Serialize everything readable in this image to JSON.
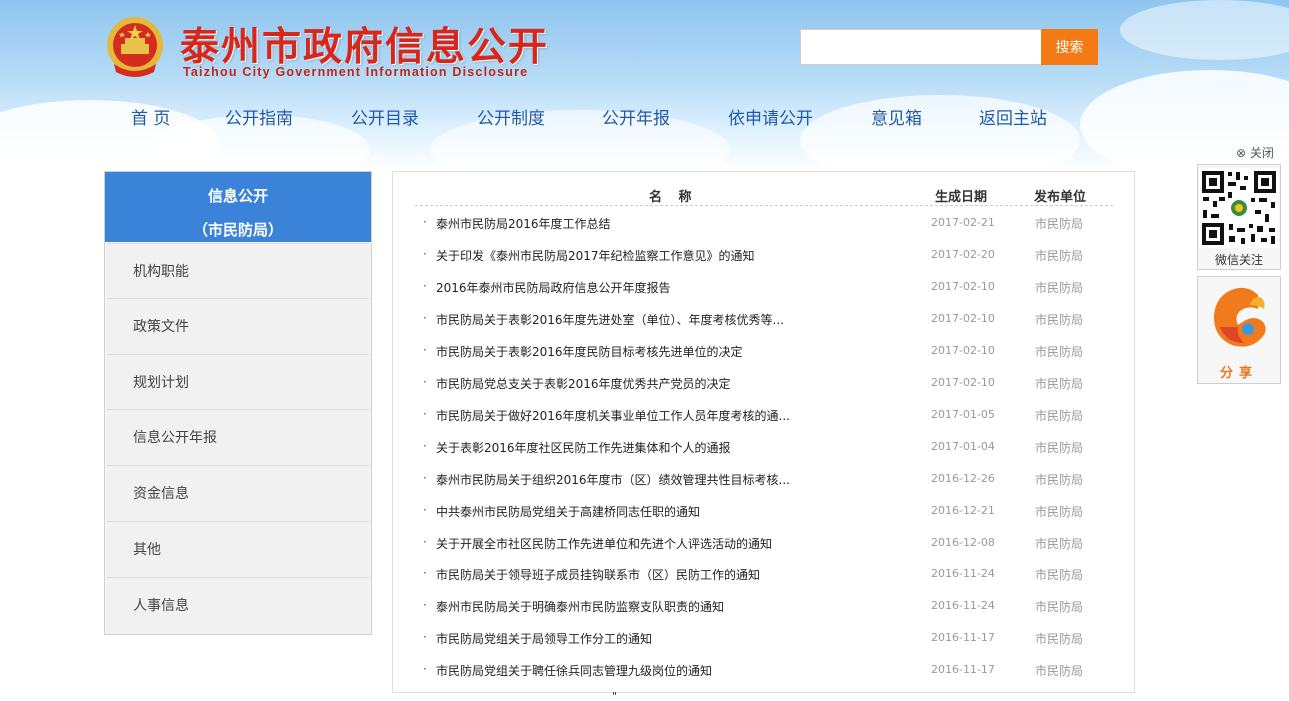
{
  "header": {
    "title": "泰州市政府信息公开",
    "subtitle": "Taizhou City Government Information Disclosure",
    "search": {
      "value": "",
      "placeholder": "",
      "button_label": "搜索"
    }
  },
  "nav": {
    "items": [
      {
        "label": "首 页"
      },
      {
        "label": "公开指南"
      },
      {
        "label": "公开目录"
      },
      {
        "label": "公开制度"
      },
      {
        "label": "公开年报"
      },
      {
        "label": "依申请公开"
      },
      {
        "label": "意见箱"
      },
      {
        "label": "返回主站"
      }
    ]
  },
  "sidebar": {
    "title": "信息公开",
    "subtitle": "（市民防局）",
    "items": [
      {
        "label": "机构职能"
      },
      {
        "label": "政策文件"
      },
      {
        "label": "规划计划"
      },
      {
        "label": "信息公开年报"
      },
      {
        "label": "资金信息"
      },
      {
        "label": "其他"
      },
      {
        "label": "人事信息"
      }
    ]
  },
  "list": {
    "columns": {
      "name": "名 称",
      "date": "生成日期",
      "unit": "发布单位"
    },
    "rows": [
      {
        "title": "泰州市民防局2016年度工作总结",
        "date": "2017-02-21",
        "unit": "市民防局"
      },
      {
        "title": "关于印发《泰州市民防局2017年纪检监察工作意见》的通知",
        "date": "2017-02-20",
        "unit": "市民防局"
      },
      {
        "title": "2016年泰州市民防局政府信息公开年度报告",
        "date": "2017-02-10",
        "unit": "市民防局"
      },
      {
        "title": "市民防局关于表彰2016年度先进处室（单位）、年度考核优秀等...",
        "date": "2017-02-10",
        "unit": "市民防局"
      },
      {
        "title": "市民防局关于表彰2016年度民防目标考核先进单位的决定",
        "date": "2017-02-10",
        "unit": "市民防局"
      },
      {
        "title": "市民防局党总支关于表彰2016年度优秀共产党员的决定",
        "date": "2017-02-10",
        "unit": "市民防局"
      },
      {
        "title": "市民防局关于做好2016年度机关事业单位工作人员年度考核的通...",
        "date": "2017-01-05",
        "unit": "市民防局"
      },
      {
        "title": "关于表彰2016年度社区民防工作先进集体和个人的通报",
        "date": "2017-01-04",
        "unit": "市民防局"
      },
      {
        "title": "泰州市民防局关于组织2016年度市（区）绩效管理共性目标考核...",
        "date": "2016-12-26",
        "unit": "市民防局"
      },
      {
        "title": "中共泰州市民防局党组关于高建桥同志任职的通知",
        "date": "2016-12-21",
        "unit": "市民防局"
      },
      {
        "title": "关于开展全市社区民防工作先进单位和先进个人评选活动的通知",
        "date": "2016-12-08",
        "unit": "市民防局"
      },
      {
        "title": "市民防局关于领导班子成员挂钩联系市（区）民防工作的通知",
        "date": "2016-11-24",
        "unit": "市民防局"
      },
      {
        "title": "泰州市民防局关于明确泰州市民防监察支队职责的通知",
        "date": "2016-11-24",
        "unit": "市民防局"
      },
      {
        "title": "市民防局党组关于局领导工作分工的通知",
        "date": "2016-11-17",
        "unit": "市民防局"
      },
      {
        "title": "市民防局党组关于聘任徐兵同志管理九级岗位的通知",
        "date": "2016-11-17",
        "unit": "市民防局"
      }
    ]
  },
  "widgets": {
    "close_label": "⊗ 关闭",
    "qr_caption": "微信关注",
    "share_caption": "分享"
  },
  "footer": {
    "mark": "\""
  },
  "colors": {
    "title_red": "#d7271c",
    "nav_blue": "#1f5aa8",
    "sidebar_head": "#3a83d9",
    "search_orange": "#f47a15"
  }
}
